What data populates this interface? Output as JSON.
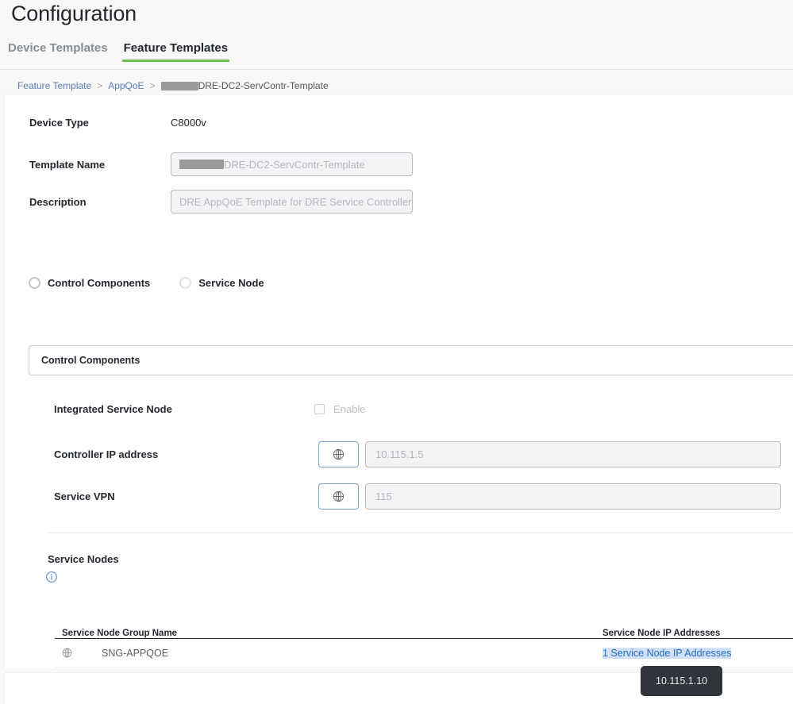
{
  "header": {
    "title": "Configuration",
    "tabs": [
      {
        "label": "Device Templates",
        "active": false
      },
      {
        "label": "Feature Templates",
        "active": true
      }
    ],
    "accent_color": "#6cc04a"
  },
  "breadcrumb": {
    "items": [
      {
        "label": "Feature Template",
        "link": true
      },
      {
        "label": "AppQoE",
        "link": true
      },
      {
        "label": "DRE-DC2-ServContr-Template",
        "link": false,
        "redacted_prefix": true
      }
    ],
    "separator": ">",
    "link_color": "#5b7eb5"
  },
  "form": {
    "device_type": {
      "label": "Device Type",
      "value": "C8000v"
    },
    "template_name": {
      "label": "Template Name",
      "value": "DRE-DC2-ServContr-Template",
      "redacted_prefix": true
    },
    "description": {
      "label": "Description",
      "value": "DRE AppQoE Template for DRE Service Controller"
    }
  },
  "mode_selector": {
    "options": [
      {
        "label": "Control Components",
        "selected": false
      },
      {
        "label": "Service Node",
        "selected": false
      }
    ]
  },
  "panel": {
    "title": "Control Components"
  },
  "settings": {
    "integrated_service_node": {
      "label": "Integrated Service Node",
      "checkbox_label": "Enable",
      "checked": false
    },
    "controller_ip": {
      "label": "Controller IP address",
      "scope_icon": "globe-icon",
      "value": "10.115.1.5"
    },
    "service_vpn": {
      "label": "Service VPN",
      "scope_icon": "globe-icon",
      "value": "115"
    }
  },
  "service_nodes": {
    "title": "Service Nodes",
    "info_icon": "info-circle-icon",
    "table": {
      "columns": [
        "Service Node Group Name",
        "Service Node IP Addresses"
      ],
      "rows": [
        {
          "scope_icon": "globe-icon",
          "group_name": "SNG-APPQOE",
          "ip_addresses_label": "1 Service Node IP Addresses"
        }
      ]
    }
  },
  "tooltip": {
    "text": "10.115.1.10"
  }
}
